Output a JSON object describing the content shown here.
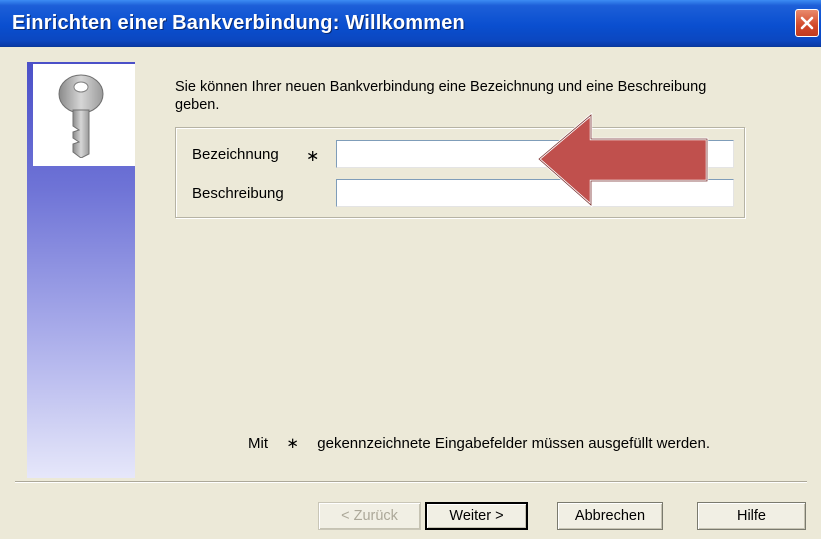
{
  "window": {
    "title": "Einrichten einer Bankverbindung: Willkommen",
    "close_label": "Schließen"
  },
  "intro_text": "Sie können Ihrer neuen Bankverbindung eine Bezeichnung und eine Beschreibung geben.",
  "form": {
    "bezeichnung": {
      "label": "Bezeichnung",
      "required_mark": "∗",
      "value": ""
    },
    "beschreibung": {
      "label": "Beschreibung",
      "value": ""
    }
  },
  "note": {
    "prefix": "Mit",
    "mark": "∗",
    "text": "gekennzeichnete Eingabefelder müssen ausgefüllt werden."
  },
  "buttons": {
    "back": "< Zurück",
    "next": "Weiter >",
    "cancel": "Abbrechen",
    "help": "Hilfe"
  },
  "icons": {
    "header_image": "key-icon",
    "annotation": "red-arrow-icon",
    "close": "close-icon"
  },
  "colors": {
    "titlebar": "#0a4fd0",
    "close_button": "#d2492a",
    "dialog_background": "#ece9d8",
    "arrow": "#c0504d"
  }
}
